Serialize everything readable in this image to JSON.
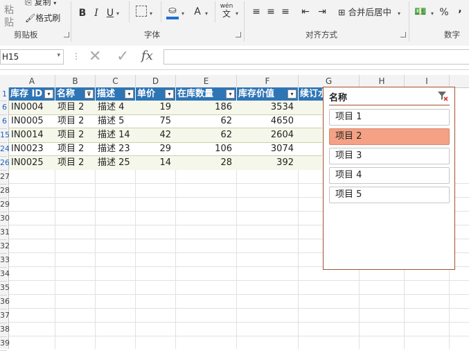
{
  "ribbon": {
    "clipboard": {
      "paste": "粘贴",
      "copy": "复制",
      "format_painter": "格式刷",
      "label": "剪贴板"
    },
    "font": {
      "bold": "B",
      "italic": "I",
      "underline": "U",
      "font_color": "A",
      "wen": "wén",
      "wen_char": "文",
      "label": "字体"
    },
    "alignment": {
      "merge_center": "合并后居中",
      "label": "对齐方式"
    },
    "number": {
      "percent": "%",
      "comma": ",",
      "label": "数字"
    }
  },
  "formula_bar": {
    "name_box": "H15",
    "fx": "fx",
    "formula": ""
  },
  "columns": [
    "A",
    "B",
    "C",
    "D",
    "E",
    "F",
    "G",
    "H",
    "I"
  ],
  "row_headers": [
    "1",
    "6",
    "6",
    "15",
    "24",
    "26",
    "27",
    "28",
    "29",
    "30",
    "31",
    "32",
    "33",
    "34",
    "35",
    "36",
    "37",
    "38",
    "39"
  ],
  "table": {
    "headers": [
      "库存 ID",
      "名称",
      "描述",
      "单价",
      "在库数量",
      "库存价值",
      "续订水"
    ],
    "rows": [
      [
        "IN0004",
        "项目 2",
        "描述 4",
        "19",
        "186",
        "3534"
      ],
      [
        "IN0005",
        "项目 2",
        "描述 5",
        "75",
        "62",
        "4650"
      ],
      [
        "IN0014",
        "项目 2",
        "描述 14",
        "42",
        "62",
        "2604"
      ],
      [
        "IN0023",
        "项目 2",
        "描述 23",
        "29",
        "106",
        "3074"
      ],
      [
        "IN0025",
        "项目 2",
        "描述 25",
        "14",
        "28",
        "392"
      ]
    ]
  },
  "slicer": {
    "title": "名称",
    "items": [
      "项目 1",
      "项目 2",
      "项目 3",
      "项目 4",
      "项目 5"
    ],
    "selected_index": 1
  },
  "colors": {
    "table_header": "#2e75b6",
    "band": "#f5f7eb",
    "slicer_selected": "#f4a185",
    "slicer_border": "#a0522d"
  }
}
